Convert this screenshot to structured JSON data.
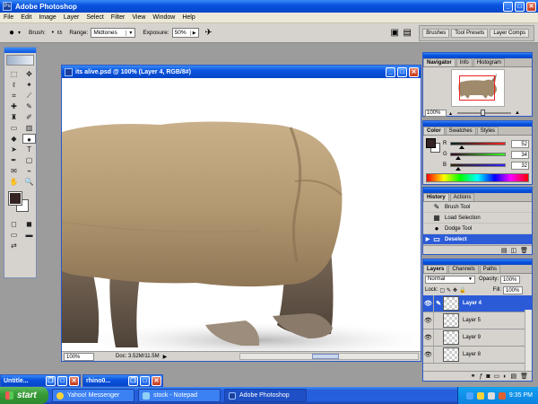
{
  "app": {
    "title": "Adobe Photoshop"
  },
  "menu": [
    "File",
    "Edit",
    "Image",
    "Layer",
    "Select",
    "Filter",
    "View",
    "Window",
    "Help"
  ],
  "options": {
    "brush_label": "Brush:",
    "brush_size": "65",
    "range_label": "Range:",
    "range_value": "Midtones",
    "exposure_label": "Exposure:",
    "exposure_value": "50%",
    "well_tabs": [
      "Brushes",
      "Tool Presets",
      "Layer Comps"
    ]
  },
  "document": {
    "title": "its alive.psd @ 100% (Layer 4, RGB/8#)",
    "zoom": "100%",
    "info": "Doc: 3.52M/11.5M"
  },
  "navigator": {
    "tabs": [
      "Navigator",
      "Info",
      "Histogram"
    ],
    "zoom": "100%"
  },
  "color": {
    "tabs": [
      "Color",
      "Swatches",
      "Styles"
    ],
    "channels": [
      {
        "label": "R",
        "value": "52",
        "fraction": 0.2
      },
      {
        "label": "G",
        "value": "34",
        "fraction": 0.13
      },
      {
        "label": "B",
        "value": "32",
        "fraction": 0.13
      }
    ],
    "fg_color": "#342322"
  },
  "history": {
    "tabs": [
      "History",
      "Actions"
    ],
    "items": [
      "Brush Tool",
      "Load Selection",
      "Dodge Tool",
      "Deselect"
    ]
  },
  "layers": {
    "tabs": [
      "Layers",
      "Channels",
      "Paths"
    ],
    "blend_mode": "Normal",
    "opacity_label": "Opacity:",
    "opacity": "100%",
    "lock_label": "Lock:",
    "fill_label": "Fill:",
    "fill": "100%",
    "items": [
      "Layer 4",
      "Layer 5",
      "Layer 9",
      "Layer 8"
    ]
  },
  "task_windows": [
    "Untitle...",
    "rhino0..."
  ],
  "taskbar": {
    "start": "start",
    "buttons": [
      "Yahoo! Messenger",
      "stock - Notepad",
      "Adobe Photoshop"
    ],
    "clock": "9:35 PM"
  },
  "colors": {
    "xp_blue": "#0a54e0",
    "selection": "#2c5bd8",
    "rhino_skin": "#b49a72"
  }
}
